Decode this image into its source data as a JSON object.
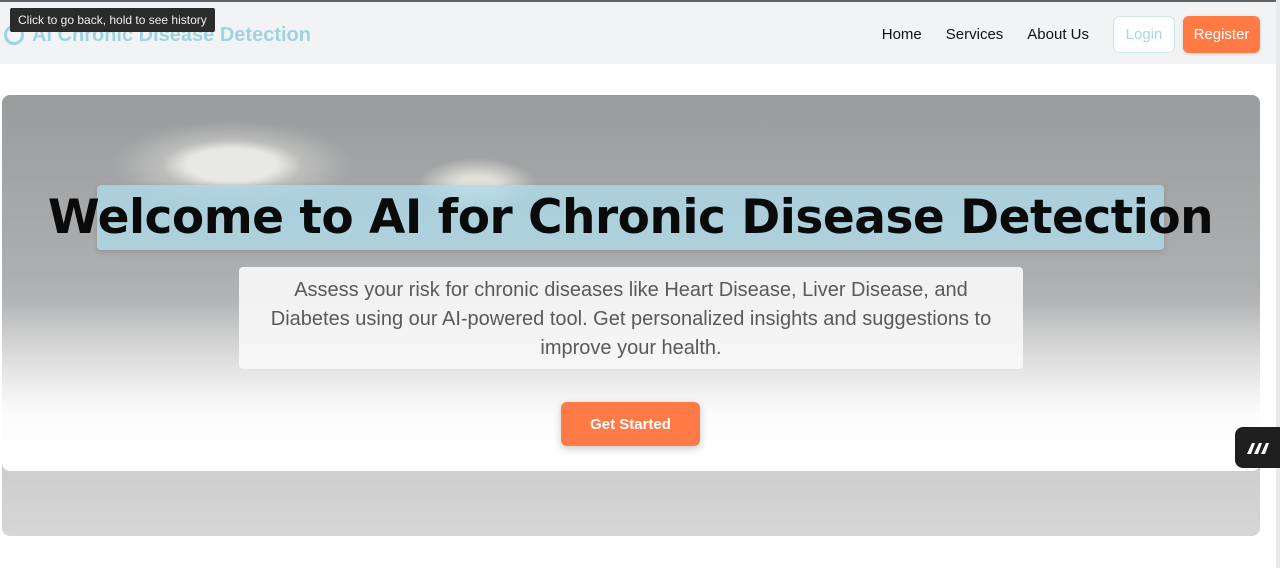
{
  "tooltip": {
    "text": "Click to go back, hold to see history"
  },
  "navbar": {
    "brand": "AI Chronic Disease Detection",
    "brand_icon": "stethoscope-icon",
    "links": [
      "Home",
      "Services",
      "About Us"
    ],
    "login_label": "Login",
    "register_label": "Register"
  },
  "hero": {
    "title": "Welcome to AI for Chronic Disease Detection",
    "subtitle": "Assess your risk for chronic diseases like Heart Disease, Liver Disease, and Diabetes using our AI-powered tool. Get personalized insights and suggestions to improve your health.",
    "cta_label": "Get Started"
  },
  "side_widget": {
    "icon": "extension-logo-icon"
  },
  "colors": {
    "accent": "#ff7a45",
    "brand_blue": "#9fd3e0",
    "title_box": "#add8e6"
  }
}
